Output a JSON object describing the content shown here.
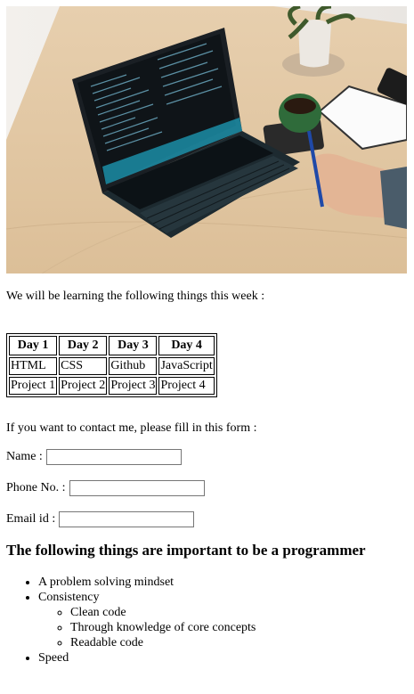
{
  "photo": {
    "alt": "Laptop with code on screen on a wooden desk"
  },
  "intro_text": "We will be learning the following things this week :",
  "schedule": {
    "headers": [
      "Day 1",
      "Day 2",
      "Day 3",
      "Day 4"
    ],
    "rows": [
      [
        "HTML",
        "CSS",
        "Github",
        "JavaScript"
      ],
      [
        "Project 1",
        "Project 2",
        "Project 3",
        "Project 4"
      ]
    ]
  },
  "contact": {
    "prompt": "If you want to contact me, please fill in this form :",
    "name_label": "Name :",
    "name_value": "",
    "phone_label": "Phone No. :",
    "phone_value": "",
    "email_label": "Email id :",
    "email_value": ""
  },
  "important": {
    "heading": "The following things are important to be a programmer",
    "items": {
      "mindset": "A problem solving mindset",
      "consistency": "Consistency",
      "consistency_sub": [
        "Clean code",
        "Through knowledge of core concepts",
        "Readable code"
      ],
      "speed": "Speed"
    }
  }
}
